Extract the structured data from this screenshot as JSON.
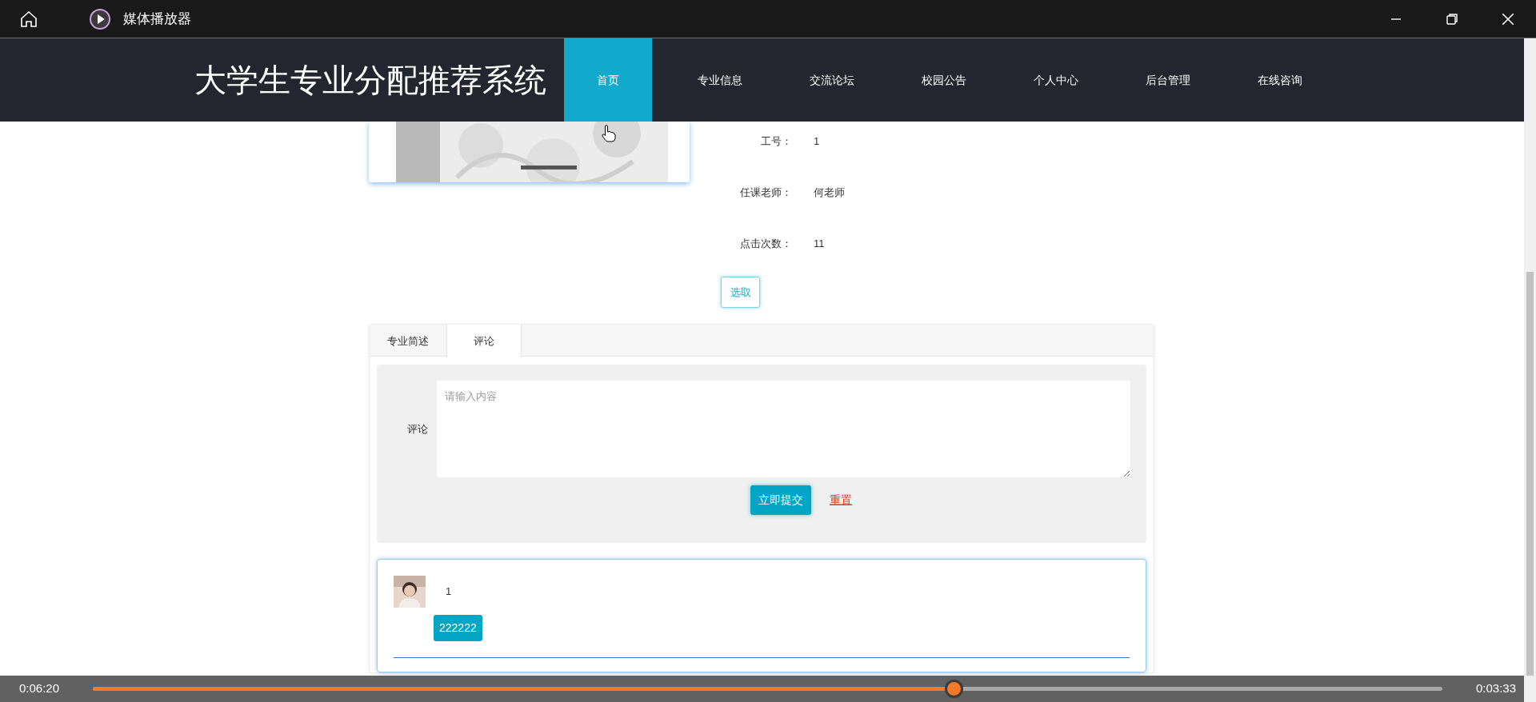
{
  "player": {
    "title": "媒体播放器",
    "elapsed": "0:06:20",
    "remaining": "0:03:33",
    "level": 0.638
  },
  "site": {
    "title": "大学生专业分配推荐系统",
    "nav": [
      {
        "label": "首页",
        "selected": true
      },
      {
        "label": "专业信息",
        "selected": false
      },
      {
        "label": "交流论坛",
        "selected": false
      },
      {
        "label": "校园公告",
        "selected": false
      },
      {
        "label": "个人中心",
        "selected": false
      },
      {
        "label": "后台管理",
        "selected": false
      },
      {
        "label": "在线咨询",
        "selected": false
      }
    ]
  },
  "details": [
    {
      "label": "工号：",
      "value": "1"
    },
    {
      "label": "任课老师：",
      "value": "何老师"
    },
    {
      "label": "点击次数：",
      "value": "11"
    }
  ],
  "select_button": "选取",
  "tabs": [
    {
      "label": "专业简述",
      "selected": false
    },
    {
      "label": "评论",
      "selected": true
    }
  ],
  "comment_form": {
    "label": "评论",
    "placeholder": "请输入内容",
    "submit": "立即提交",
    "reset": "重置"
  },
  "comments": [
    {
      "user": "1",
      "text": "222222"
    }
  ]
}
